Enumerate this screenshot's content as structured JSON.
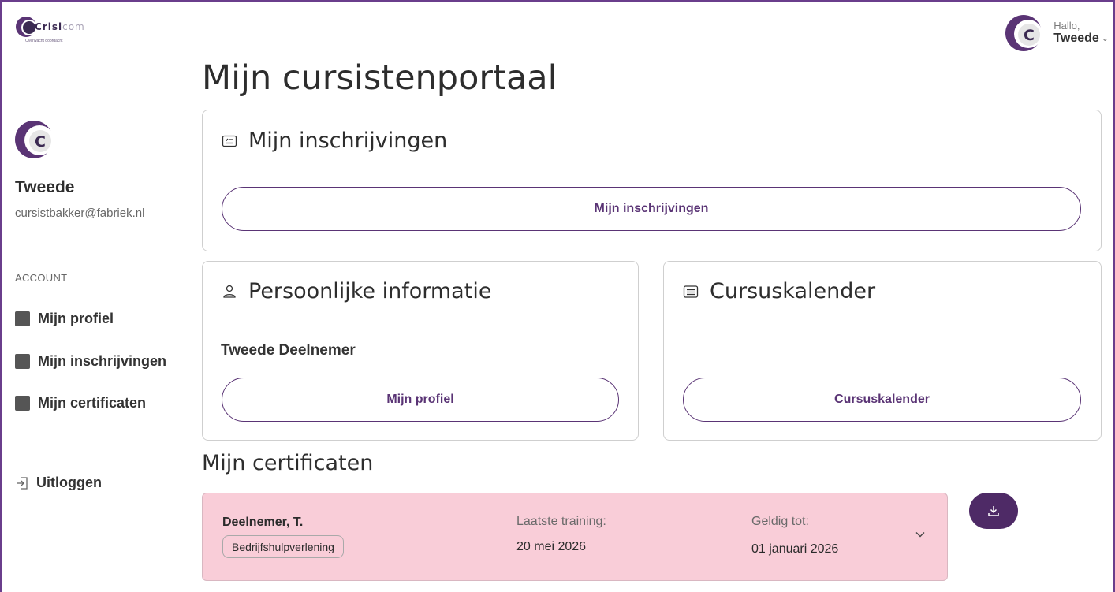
{
  "brand": {
    "logo_text_a": "Crisi",
    "logo_text_b": "com",
    "tagline": "Overwacht doordacht"
  },
  "header": {
    "greeting": "Hallo,",
    "user_name": "Tweede"
  },
  "page": {
    "title": "Mijn cursistenportaal"
  },
  "sidebar": {
    "name": "Tweede",
    "email": "cursistbakker@fabriek.nl",
    "section_label": "ACCOUNT",
    "items": [
      {
        "label": "Mijn profiel"
      },
      {
        "label": "Mijn inschrijvingen"
      },
      {
        "label": "Mijn certificaten"
      }
    ],
    "logout_label": "Uitloggen"
  },
  "cards": {
    "inschrijvingen": {
      "title": "Mijn inschrijvingen",
      "button": "Mijn inschrijvingen"
    },
    "persoonlijk": {
      "title": "Persoonlijke informatie",
      "full_name": "Tweede Deelnemer",
      "button": "Mijn profiel"
    },
    "kalender": {
      "title": "Cursuskalender",
      "button": "Cursuskalender"
    }
  },
  "certificates": {
    "heading": "Mijn certificaten",
    "items": [
      {
        "name": "Deelnemer, T.",
        "course": "Bedrijfshulpverlening",
        "last_training_label": "Laatste training:",
        "last_training": "20 mei 2026",
        "valid_until_label": "Geldig tot:",
        "valid_until": "01 januari 2026"
      }
    ]
  },
  "colors": {
    "accent": "#5a3475",
    "frame": "#6a3d8c",
    "certificate_bg": "#f9cdd8",
    "download_button": "#4e2a66"
  }
}
